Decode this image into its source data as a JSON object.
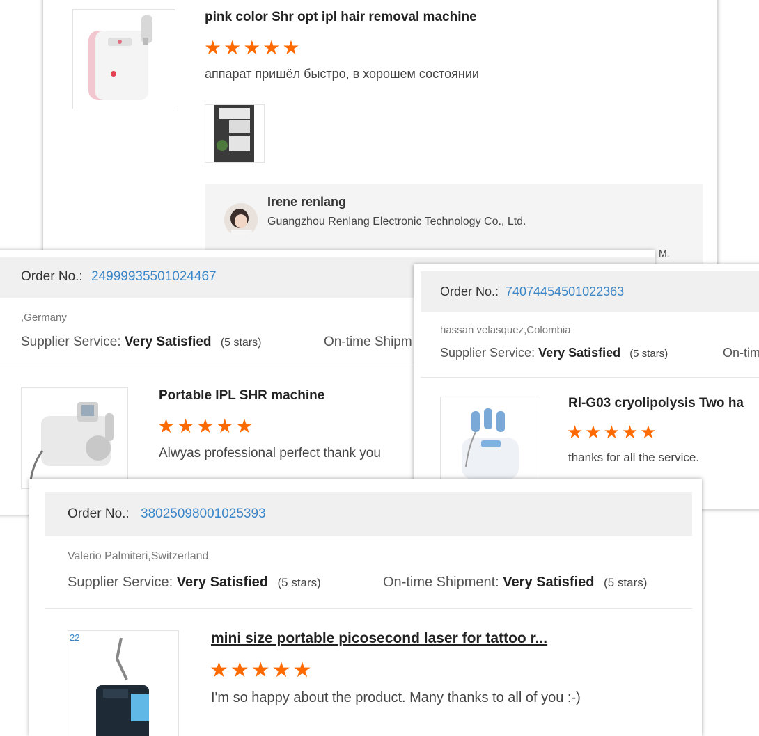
{
  "card_top": {
    "product_title": "pink color Shr opt ipl hair removal machine",
    "stars": "★★★★★",
    "review": "аппарат пришёл быстро, в хорошем состоянии",
    "reply": {
      "name": "Irene renlang",
      "company": "Guangzhou Renlang Electronic Technology Co., Ltd.",
      "cut_text": "M."
    }
  },
  "card_germany": {
    "order_label": "Order No.:",
    "order_no": "24999935501024467",
    "buyer": ",Germany",
    "supplier_label": "Supplier Service:",
    "supplier_value": "Very Satisfied",
    "supplier_stars": "(5 stars)",
    "shipment_label": "On-time Shipm",
    "product_title": "Portable IPL SHR machine",
    "stars": "★★★★★",
    "review": "Alwyas professional perfect thank you"
  },
  "card_colombia": {
    "order_label": "Order No.:",
    "order_no": "74074454501022363",
    "buyer": "hassan velasquez,Colombia",
    "supplier_label": "Supplier Service:",
    "supplier_value": "Very Satisfied",
    "supplier_stars": "(5 stars)",
    "shipment_label": "On-tim",
    "product_title": "Rl-G03 cryolipolysis Two ha",
    "stars": "★★★★★",
    "review": "thanks for all the service."
  },
  "card_switzerland": {
    "order_label": "Order No.:",
    "order_no": "38025098001025393",
    "buyer": "Valerio Palmiteri,Switzerland",
    "supplier_label": "Supplier Service:",
    "supplier_value": "Very Satisfied",
    "supplier_stars": "(5 stars)",
    "shipment_label": "On-time Shipment:",
    "shipment_value": "Very Satisfied",
    "shipment_stars": "(5 stars)",
    "product_title": "mini size portable picosecond laser for tattoo r...",
    "stars": "★★★★★",
    "review": "I'm so happy about the product. Many thanks to all of you :-)"
  },
  "colors": {
    "star": "#ff6a00",
    "order_link": "#3a86c8",
    "order_bar": "#f0f0f0"
  }
}
